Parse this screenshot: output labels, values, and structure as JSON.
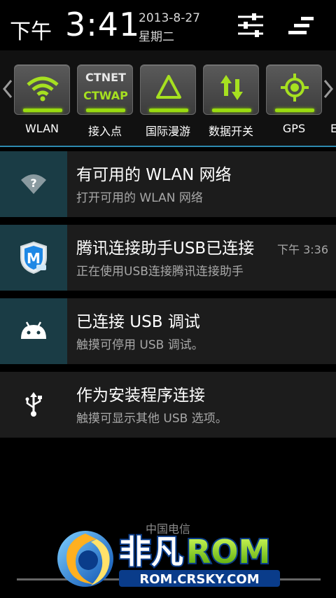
{
  "status_header": {
    "ampm": "下午",
    "time": "3:41",
    "date": "2013-8-27",
    "weekday": "星期二"
  },
  "toggles": [
    {
      "label": "WLAN",
      "icon": "wifi-icon"
    },
    {
      "label": "接入点",
      "line1": "CTNET",
      "line2": "CTWAP"
    },
    {
      "label": "国际漫游",
      "icon": "roaming-triangle-icon"
    },
    {
      "label": "数据开关",
      "icon": "data-arrows-icon"
    },
    {
      "label": "GPS",
      "icon": "gps-crosshair-icon"
    }
  ],
  "toggle_partial_label": "E",
  "notifications": [
    {
      "title": "有可用的 WLAN 网络",
      "subtitle": "打开可用的 WLAN 网络",
      "time": "",
      "icon": "wifi-question-icon"
    },
    {
      "title": "腾讯连接助手USB已连接",
      "subtitle": "正在使用USB连接腾讯连接助手",
      "time": "下午 3:36",
      "icon": "tencent-shield-icon"
    },
    {
      "title": "已连接 USB 调试",
      "subtitle": "触摸可停用 USB 调试。",
      "time": "",
      "icon": "android-icon"
    },
    {
      "title": "作为安装程序连接",
      "subtitle": "触摸可显示其他 USB 选项。",
      "time": "",
      "icon": "usb-icon"
    }
  ],
  "carrier": "中国电信",
  "watermark": {
    "brand_cn": "非凡",
    "brand_en": "ROM",
    "url": "ROM.CRSKY.COM"
  },
  "colors": {
    "accent_green": "#9adc10",
    "divider_cyan": "#2d8ab0",
    "icon_box": "#1a3c45"
  }
}
